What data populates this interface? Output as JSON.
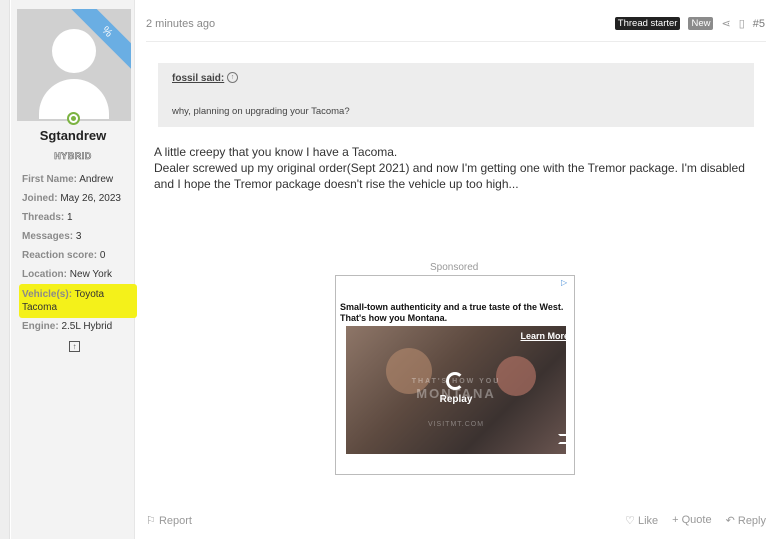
{
  "user": {
    "name": "Sgtandrew",
    "title": "HYBRID",
    "ribbon_icon": "%",
    "fields": [
      {
        "key": "First Name:",
        "value": "Andrew"
      },
      {
        "key": "Joined:",
        "value": "May 26, 2023"
      },
      {
        "key": "Threads:",
        "value": "1"
      },
      {
        "key": "Messages:",
        "value": "3"
      },
      {
        "key": "Reaction score:",
        "value": "0"
      },
      {
        "key": "Location:",
        "value": "New York"
      },
      {
        "key": "Vehicle(s):",
        "value": "Toyota Tacoma"
      },
      {
        "key": "Engine:",
        "value": "2.5L Hybrid"
      }
    ]
  },
  "post": {
    "time": "2 minutes ago",
    "badge_starter": "Thread starter",
    "badge_new": "New",
    "number": "#5",
    "quote": {
      "author": "fossil said:",
      "text": "why, planning on upgrading your Tacoma?"
    },
    "body_line1": "A little creepy that you know I have a Tacoma.",
    "body_line2": "Dealer screwed up my original order(Sept 2021) and now I'm getting one with the Tremor package. I'm disabled and I hope the Tremor package doesn't rise the vehicle up too high..."
  },
  "ad": {
    "sponsored_label": "Sponsored",
    "headline": "Small-town authenticity and a true taste of the West. That's how you Montana.",
    "learn_more": "Learn More",
    "overlay_line": "THAT'S HOW YOU",
    "overlay_brand": "MONTANA",
    "overlay_url": "VISITMT.COM",
    "replay": "Replay"
  },
  "footer": {
    "report": "Report",
    "like": "Like",
    "quote": "+ Quote",
    "reply": "Reply"
  }
}
